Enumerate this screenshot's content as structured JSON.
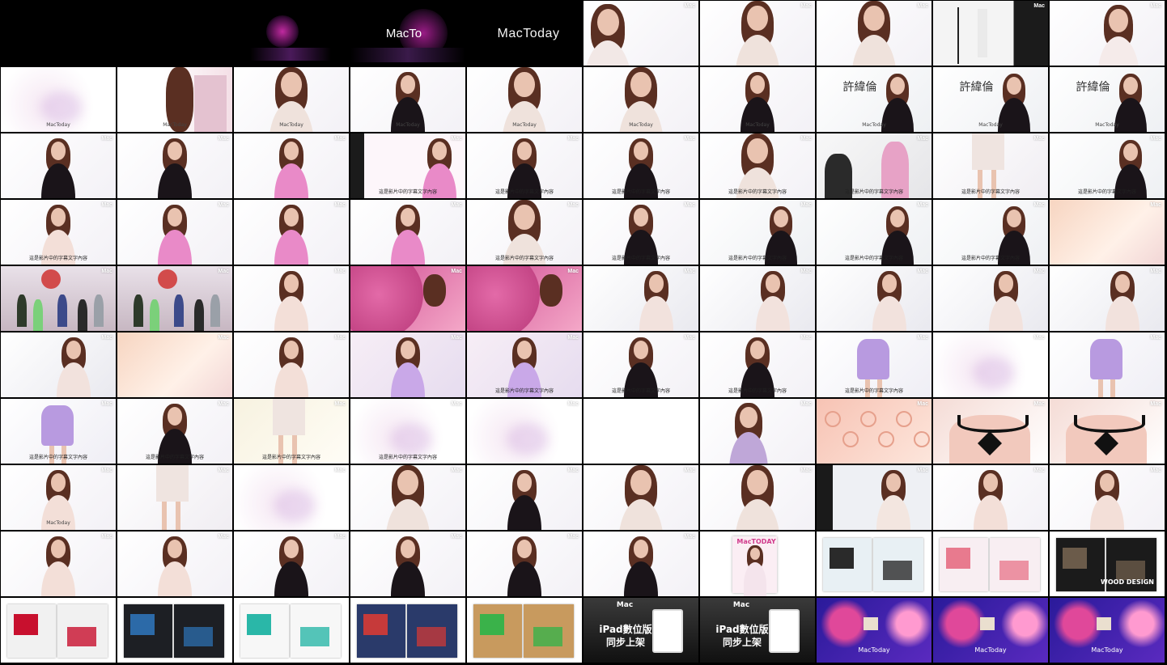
{
  "title_frames": {
    "logo_partial": "MacTo",
    "logo_full": "MacToday"
  },
  "watermark": "Mac",
  "footer_caption": "MacToday",
  "subtitles": {
    "row1_name": "許緯倫",
    "ipad_promo_line1": "iPad數位版",
    "ipad_promo_line2": "同步上架",
    "magazine_cover_title": "MacTODAY",
    "wood_design": "WOOD DESIGN",
    "sample_caption": "這是影片中的字幕文字內容"
  },
  "colors": {
    "background": "#000000",
    "studio_white": "#f3f1f6",
    "pink_dress": "#e98ac8",
    "black_top": "#1a1419",
    "skin": "#e9c3b0",
    "hair": "#5a2f22",
    "purple_accent": "#7a3ad8",
    "end_card_blue": "#2a2a9a"
  },
  "tiles": [
    {
      "type": "black"
    },
    {
      "type": "black"
    },
    {
      "type": "logo_small"
    },
    {
      "type": "logo_partial"
    },
    {
      "type": "logo_full"
    },
    {
      "type": "portrait",
      "variant": "hair_left",
      "wm": true
    },
    {
      "type": "portrait",
      "variant": "face",
      "wm": true
    },
    {
      "type": "portrait",
      "variant": "face2",
      "wm": true
    },
    {
      "type": "studio_stool",
      "wm": true
    },
    {
      "type": "portrait",
      "variant": "arm_up",
      "wm": true
    },
    {
      "type": "white_blur",
      "cap": true
    },
    {
      "type": "hair_close",
      "cap": true
    },
    {
      "type": "portrait",
      "variant": "face3",
      "cap": true
    },
    {
      "type": "portrait",
      "variant": "black",
      "cap": true
    },
    {
      "type": "portrait",
      "variant": "face4",
      "cap": true
    },
    {
      "type": "portrait",
      "variant": "face5",
      "cap": true
    },
    {
      "type": "portrait",
      "variant": "black",
      "cap": true
    },
    {
      "type": "interview",
      "name": true,
      "cap": true
    },
    {
      "type": "interview",
      "name": true,
      "cap": true
    },
    {
      "type": "interview",
      "name": true,
      "cap": true
    },
    {
      "type": "portrait",
      "variant": "black",
      "wm": true
    },
    {
      "type": "portrait",
      "variant": "black",
      "wm": true
    },
    {
      "type": "portrait",
      "variant": "pink",
      "wm": true
    },
    {
      "type": "portrait",
      "variant": "pink_side",
      "wm": true,
      "sub": true
    },
    {
      "type": "portrait",
      "variant": "black",
      "wm": true,
      "sub": true
    },
    {
      "type": "portrait",
      "variant": "black",
      "wm": true,
      "sub": true
    },
    {
      "type": "portrait",
      "variant": "face5",
      "wm": true,
      "sub": true
    },
    {
      "type": "makeup",
      "wm": true,
      "sub": true
    },
    {
      "type": "legs",
      "wm": true,
      "sub": true
    },
    {
      "type": "interview",
      "wm": true,
      "sub": true
    },
    {
      "type": "portrait",
      "variant": "white",
      "wm": true,
      "sub": true
    },
    {
      "type": "portrait",
      "variant": "pink",
      "wm": true
    },
    {
      "type": "portrait",
      "variant": "pink_arms",
      "wm": true
    },
    {
      "type": "portrait",
      "variant": "pink_arms",
      "wm": true
    },
    {
      "type": "portrait",
      "variant": "face4",
      "wm": true,
      "sub": true
    },
    {
      "type": "portrait",
      "variant": "black",
      "wm": true,
      "sub": true
    },
    {
      "type": "interview",
      "wm": true,
      "sub": true
    },
    {
      "type": "interview",
      "wm": true,
      "sub": true
    },
    {
      "type": "interview",
      "wm": true,
      "sub": true
    },
    {
      "type": "warm_blur",
      "wm": true
    },
    {
      "type": "studio_crew",
      "wm": true
    },
    {
      "type": "studio_crew",
      "wm": true
    },
    {
      "type": "portrait",
      "variant": "soft",
      "wm": true
    },
    {
      "type": "umbrella",
      "wm": true
    },
    {
      "type": "umbrella",
      "wm": true
    },
    {
      "type": "portrait",
      "variant": "phone",
      "wm": true
    },
    {
      "type": "portrait",
      "variant": "phone",
      "wm": true
    },
    {
      "type": "portrait",
      "variant": "phone",
      "wm": true
    },
    {
      "type": "portrait",
      "variant": "phone",
      "wm": true
    },
    {
      "type": "portrait",
      "variant": "phone",
      "wm": true
    },
    {
      "type": "portrait",
      "variant": "phone",
      "wm": true
    },
    {
      "type": "warm_blur",
      "wm": true
    },
    {
      "type": "portrait",
      "variant": "white",
      "wm": true
    },
    {
      "type": "portrait",
      "variant": "purple_soft",
      "wm": true
    },
    {
      "type": "portrait",
      "variant": "purple_soft",
      "wm": true,
      "sub": true
    },
    {
      "type": "portrait",
      "variant": "black",
      "wm": true,
      "sub": true
    },
    {
      "type": "portrait",
      "variant": "black",
      "wm": true,
      "sub": true
    },
    {
      "type": "purple_dress",
      "wm": true,
      "sub": true
    },
    {
      "type": "white_blur",
      "wm": true
    },
    {
      "type": "purple_dress",
      "wm": true
    },
    {
      "type": "purple_dress",
      "wm": true,
      "sub": true
    },
    {
      "type": "portrait",
      "variant": "black",
      "wm": true,
      "sub": true
    },
    {
      "type": "legs_yellow",
      "wm": true,
      "sub": true
    },
    {
      "type": "white_blur",
      "wm": true,
      "sub": true
    },
    {
      "type": "white_blur",
      "wm": true
    },
    {
      "type": "blank"
    },
    {
      "type": "portrait",
      "variant": "lying",
      "wm": true
    },
    {
      "type": "lace_close",
      "wm": true
    },
    {
      "type": "lace_black",
      "wm": true
    },
    {
      "type": "lace_black",
      "wm": true
    },
    {
      "type": "portrait",
      "variant": "white",
      "wm": true,
      "cap": true
    },
    {
      "type": "legs",
      "wm": true
    },
    {
      "type": "white_blur",
      "wm": true
    },
    {
      "type": "portrait",
      "variant": "face3",
      "wm": true
    },
    {
      "type": "portrait",
      "variant": "black",
      "wm": true
    },
    {
      "type": "portrait",
      "variant": "face5",
      "wm": true
    },
    {
      "type": "portrait",
      "variant": "face4",
      "wm": true
    },
    {
      "type": "portrait",
      "variant": "dark_corner",
      "wm": true
    },
    {
      "type": "portrait",
      "variant": "white",
      "wm": true
    },
    {
      "type": "portrait",
      "variant": "white",
      "wm": true
    },
    {
      "type": "portrait",
      "variant": "white",
      "wm": true
    },
    {
      "type": "portrait",
      "variant": "white",
      "wm": true
    },
    {
      "type": "portrait",
      "variant": "black",
      "wm": true
    },
    {
      "type": "portrait",
      "variant": "black",
      "wm": true
    },
    {
      "type": "portrait",
      "variant": "black",
      "wm": true
    },
    {
      "type": "portrait",
      "variant": "black",
      "wm": true
    },
    {
      "type": "mag_cover"
    },
    {
      "type": "mag_spread_tech"
    },
    {
      "type": "mag_spread_fashion"
    },
    {
      "type": "mag_spread_wood"
    },
    {
      "type": "mag_spread_red"
    },
    {
      "type": "mag_spread_dark"
    },
    {
      "type": "mag_spread_white"
    },
    {
      "type": "mag_spread_app"
    },
    {
      "type": "mag_spread_green"
    },
    {
      "type": "ipad_promo"
    },
    {
      "type": "ipad_promo"
    },
    {
      "type": "end_card"
    },
    {
      "type": "end_card"
    },
    {
      "type": "end_card"
    }
  ]
}
